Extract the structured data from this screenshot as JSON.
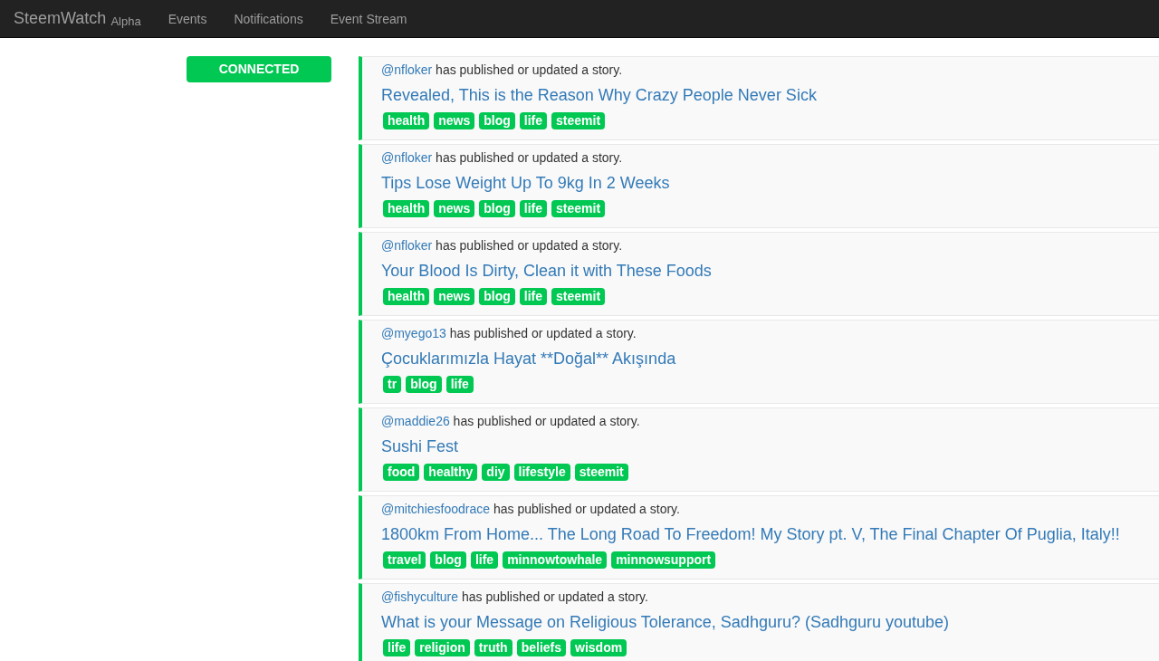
{
  "navbar": {
    "brand": "SteemWatch",
    "brand_tag": "Alpha",
    "links": [
      "Events",
      "Notifications",
      "Event Stream"
    ]
  },
  "status": {
    "label": "CONNECTED"
  },
  "events": [
    {
      "author": "@nfloker",
      "action": "has published or updated a story.",
      "title": "Revealed, This is the Reason Why Crazy People Never Sick",
      "tags": [
        "health",
        "news",
        "blog",
        "life",
        "steemit"
      ]
    },
    {
      "author": "@nfloker",
      "action": "has published or updated a story.",
      "title": "Tips Lose Weight Up To 9kg In 2 Weeks",
      "tags": [
        "health",
        "news",
        "blog",
        "life",
        "steemit"
      ]
    },
    {
      "author": "@nfloker",
      "action": "has published or updated a story.",
      "title": "Your Blood Is Dirty, Clean it with These Foods",
      "tags": [
        "health",
        "news",
        "blog",
        "life",
        "steemit"
      ]
    },
    {
      "author": "@myego13",
      "action": "has published or updated a story.",
      "title": "Çocuklarımızla Hayat **Doğal** Akışında",
      "tags": [
        "tr",
        "blog",
        "life"
      ]
    },
    {
      "author": "@maddie26",
      "action": "has published or updated a story.",
      "title": "Sushi Fest",
      "tags": [
        "food",
        "healthy",
        "diy",
        "lifestyle",
        "steemit"
      ]
    },
    {
      "author": "@mitchiesfoodrace",
      "action": "has published or updated a story.",
      "title": "1800km From Home... The Long Road To Freedom! My Story pt. V, The Final Chapter Of Puglia, Italy!!",
      "tags": [
        "travel",
        "blog",
        "life",
        "minnowtowhale",
        "minnowsupport"
      ]
    },
    {
      "author": "@fishyculture",
      "action": "has published or updated a story.",
      "title": "What is your Message on Religious Tolerance, Sadhguru? (Sadhguru youtube)",
      "tags": [
        "life",
        "religion",
        "truth",
        "beliefs",
        "wisdom"
      ]
    }
  ]
}
